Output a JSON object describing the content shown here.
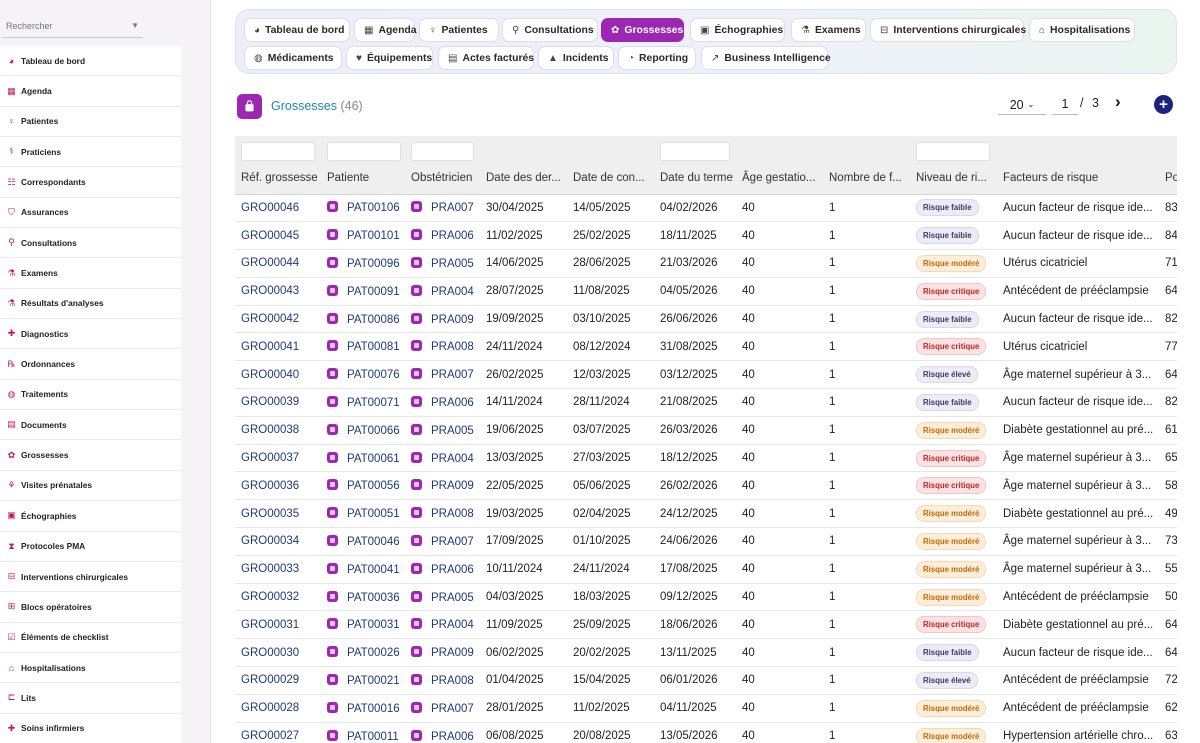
{
  "sidebar": {
    "search_placeholder": "Rechercher",
    "items": [
      {
        "label": "Tableau de bord",
        "icon": "dashboard-icon"
      },
      {
        "label": "Agenda",
        "icon": "calendar-icon"
      },
      {
        "label": "Patientes",
        "icon": "female-icon"
      },
      {
        "label": "Praticiens",
        "icon": "doctor-icon"
      },
      {
        "label": "Correspondants",
        "icon": "contacts-icon"
      },
      {
        "label": "Assurances",
        "icon": "shield-icon"
      },
      {
        "label": "Consultations",
        "icon": "stethoscope-icon"
      },
      {
        "label": "Examens",
        "icon": "exam-icon"
      },
      {
        "label": "Résultats d'analyses",
        "icon": "lab-icon"
      },
      {
        "label": "Diagnostics",
        "icon": "diagnostic-icon"
      },
      {
        "label": "Ordonnances",
        "icon": "prescription-icon"
      },
      {
        "label": "Traitements",
        "icon": "pill-icon"
      },
      {
        "label": "Documents",
        "icon": "document-icon"
      },
      {
        "label": "Grossesses",
        "icon": "pregnancy-icon"
      },
      {
        "label": "Visites prénatales",
        "icon": "visit-icon"
      },
      {
        "label": "Échographies",
        "icon": "ultrasound-icon"
      },
      {
        "label": "Protocoles PMA",
        "icon": "dna-icon"
      },
      {
        "label": "Interventions chirurgicales",
        "icon": "surgery-bed-icon"
      },
      {
        "label": "Blocs opératoires",
        "icon": "operating-room-icon"
      },
      {
        "label": "Éléments de checklist",
        "icon": "checklist-icon"
      },
      {
        "label": "Hospitalisations",
        "icon": "hospital-icon"
      },
      {
        "label": "Lits",
        "icon": "bed-icon"
      },
      {
        "label": "Soins infirmiers",
        "icon": "nursing-icon"
      }
    ]
  },
  "topnav": {
    "tabs": [
      {
        "label": "Tableau de bord",
        "icon": "dashboard-icon",
        "active": false
      },
      {
        "label": "Agenda",
        "icon": "calendar-icon",
        "active": false
      },
      {
        "label": "Patientes",
        "icon": "female-icon",
        "active": false
      },
      {
        "label": "Consultations",
        "icon": "stethoscope-icon",
        "active": false
      },
      {
        "label": "Grossesses",
        "icon": "pregnancy-icon",
        "active": true
      },
      {
        "label": "Échographies",
        "icon": "ultrasound-icon",
        "active": false
      },
      {
        "label": "Examens",
        "icon": "exam-icon",
        "active": false
      },
      {
        "label": "Interventions chirurgicales",
        "icon": "surgery-bed-icon",
        "active": false
      },
      {
        "label": "Hospitalisations",
        "icon": "hospital-icon",
        "active": false
      },
      {
        "label": "Médicaments",
        "icon": "pill-icon",
        "active": false
      },
      {
        "label": "Équipements",
        "icon": "equipment-icon",
        "active": false
      },
      {
        "label": "Actes facturés",
        "icon": "invoice-icon",
        "active": false
      },
      {
        "label": "Incidents",
        "icon": "warning-icon",
        "active": false
      },
      {
        "label": "Reporting",
        "icon": "pie-chart-icon",
        "active": false
      },
      {
        "label": "Business Intelligence",
        "icon": "line-chart-icon",
        "active": false
      }
    ]
  },
  "page": {
    "title": "Grossesses",
    "count": "(46)",
    "accent": "#9c27b0"
  },
  "pagination": {
    "per_page": "20",
    "current": "1",
    "separator": "/",
    "total": "3",
    "next_glyph": "›",
    "add_glyph": "+"
  },
  "table": {
    "columns": [
      "Réf. grossesse",
      "Patiente",
      "Obstétricien",
      "Date des der...",
      "Date de con...",
      "Date du terme",
      "Âge gestatio...",
      "Nombre de f...",
      "Niveau de ri...",
      "Facteurs de risque",
      "Po"
    ],
    "rows": [
      {
        "ref": "GRO00046",
        "patiente": "PAT00106",
        "obst": "PRA007",
        "d1": "30/04/2025",
        "d2": "14/05/2025",
        "d3": "04/02/2026",
        "age": "40",
        "nb": "1",
        "risk": "Risque faible",
        "risk_class": "faible",
        "facteurs": "Aucun facteur de risque ide...",
        "po": "83"
      },
      {
        "ref": "GRO00045",
        "patiente": "PAT00101",
        "obst": "PRA006",
        "d1": "11/02/2025",
        "d2": "25/02/2025",
        "d3": "18/11/2025",
        "age": "40",
        "nb": "1",
        "risk": "Risque faible",
        "risk_class": "faible",
        "facteurs": "Aucun facteur de risque ide...",
        "po": "84"
      },
      {
        "ref": "GRO00044",
        "patiente": "PAT00096",
        "obst": "PRA005",
        "d1": "14/06/2025",
        "d2": "28/06/2025",
        "d3": "21/03/2026",
        "age": "40",
        "nb": "1",
        "risk": "Risque modéré",
        "risk_class": "modere",
        "facteurs": "Utérus cicatriciel",
        "po": "71"
      },
      {
        "ref": "GRO00043",
        "patiente": "PAT00091",
        "obst": "PRA004",
        "d1": "28/07/2025",
        "d2": "11/08/2025",
        "d3": "04/05/2026",
        "age": "40",
        "nb": "1",
        "risk": "Risque critique",
        "risk_class": "critique",
        "facteurs": "Antécédent de prééclampsie",
        "po": "64"
      },
      {
        "ref": "GRO00042",
        "patiente": "PAT00086",
        "obst": "PRA009",
        "d1": "19/09/2025",
        "d2": "03/10/2025",
        "d3": "26/06/2026",
        "age": "40",
        "nb": "1",
        "risk": "Risque faible",
        "risk_class": "faible",
        "facteurs": "Aucun facteur de risque ide...",
        "po": "82"
      },
      {
        "ref": "GRO00041",
        "patiente": "PAT00081",
        "obst": "PRA008",
        "d1": "24/11/2024",
        "d2": "08/12/2024",
        "d3": "31/08/2025",
        "age": "40",
        "nb": "1",
        "risk": "Risque critique",
        "risk_class": "critique",
        "facteurs": "Utérus cicatriciel",
        "po": "77"
      },
      {
        "ref": "GRO00040",
        "patiente": "PAT00076",
        "obst": "PRA007",
        "d1": "26/02/2025",
        "d2": "12/03/2025",
        "d3": "03/12/2025",
        "age": "40",
        "nb": "1",
        "risk": "Risque élevé",
        "risk_class": "eleve",
        "facteurs": "Âge maternel supérieur à 3...",
        "po": "64"
      },
      {
        "ref": "GRO00039",
        "patiente": "PAT00071",
        "obst": "PRA006",
        "d1": "14/11/2024",
        "d2": "28/11/2024",
        "d3": "21/08/2025",
        "age": "40",
        "nb": "1",
        "risk": "Risque faible",
        "risk_class": "faible",
        "facteurs": "Aucun facteur de risque ide...",
        "po": "82"
      },
      {
        "ref": "GRO00038",
        "patiente": "PAT00066",
        "obst": "PRA005",
        "d1": "19/06/2025",
        "d2": "03/07/2025",
        "d3": "26/03/2026",
        "age": "40",
        "nb": "1",
        "risk": "Risque modéré",
        "risk_class": "modere",
        "facteurs": "Diabète gestationnel au pré...",
        "po": "61"
      },
      {
        "ref": "GRO00037",
        "patiente": "PAT00061",
        "obst": "PRA004",
        "d1": "13/03/2025",
        "d2": "27/03/2025",
        "d3": "18/12/2025",
        "age": "40",
        "nb": "1",
        "risk": "Risque critique",
        "risk_class": "critique",
        "facteurs": "Âge maternel supérieur à 3...",
        "po": "65"
      },
      {
        "ref": "GRO00036",
        "patiente": "PAT00056",
        "obst": "PRA009",
        "d1": "22/05/2025",
        "d2": "05/06/2025",
        "d3": "26/02/2026",
        "age": "40",
        "nb": "1",
        "risk": "Risque critique",
        "risk_class": "critique",
        "facteurs": "Âge maternel supérieur à 3...",
        "po": "58"
      },
      {
        "ref": "GRO00035",
        "patiente": "PAT00051",
        "obst": "PRA008",
        "d1": "19/03/2025",
        "d2": "02/04/2025",
        "d3": "24/12/2025",
        "age": "40",
        "nb": "1",
        "risk": "Risque modéré",
        "risk_class": "modere",
        "facteurs": "Diabète gestationnel au pré...",
        "po": "49"
      },
      {
        "ref": "GRO00034",
        "patiente": "PAT00046",
        "obst": "PRA007",
        "d1": "17/09/2025",
        "d2": "01/10/2025",
        "d3": "24/06/2026",
        "age": "40",
        "nb": "1",
        "risk": "Risque modéré",
        "risk_class": "modere",
        "facteurs": "Âge maternel supérieur à 3...",
        "po": "73"
      },
      {
        "ref": "GRO00033",
        "patiente": "PAT00041",
        "obst": "PRA006",
        "d1": "10/11/2024",
        "d2": "24/11/2024",
        "d3": "17/08/2025",
        "age": "40",
        "nb": "1",
        "risk": "Risque modéré",
        "risk_class": "modere",
        "facteurs": "Âge maternel supérieur à 3...",
        "po": "55"
      },
      {
        "ref": "GRO00032",
        "patiente": "PAT00036",
        "obst": "PRA005",
        "d1": "04/03/2025",
        "d2": "18/03/2025",
        "d3": "09/12/2025",
        "age": "40",
        "nb": "1",
        "risk": "Risque modéré",
        "risk_class": "modere",
        "facteurs": "Antécédent de prééclampsie",
        "po": "50"
      },
      {
        "ref": "GRO00031",
        "patiente": "PAT00031",
        "obst": "PRA004",
        "d1": "11/09/2025",
        "d2": "25/09/2025",
        "d3": "18/06/2026",
        "age": "40",
        "nb": "1",
        "risk": "Risque critique",
        "risk_class": "critique",
        "facteurs": "Diabète gestationnel au pré...",
        "po": "64"
      },
      {
        "ref": "GRO00030",
        "patiente": "PAT00026",
        "obst": "PRA009",
        "d1": "06/02/2025",
        "d2": "20/02/2025",
        "d3": "13/11/2025",
        "age": "40",
        "nb": "1",
        "risk": "Risque faible",
        "risk_class": "faible",
        "facteurs": "Aucun facteur de risque ide...",
        "po": "64"
      },
      {
        "ref": "GRO00029",
        "patiente": "PAT00021",
        "obst": "PRA008",
        "d1": "01/04/2025",
        "d2": "15/04/2025",
        "d3": "06/01/2026",
        "age": "40",
        "nb": "1",
        "risk": "Risque élevé",
        "risk_class": "eleve",
        "facteurs": "Antécédent de prééclampsie",
        "po": "72"
      },
      {
        "ref": "GRO00028",
        "patiente": "PAT00016",
        "obst": "PRA007",
        "d1": "28/01/2025",
        "d2": "11/02/2025",
        "d3": "04/11/2025",
        "age": "40",
        "nb": "1",
        "risk": "Risque modéré",
        "risk_class": "modere",
        "facteurs": "Antécédent de prééclampsie",
        "po": "62"
      },
      {
        "ref": "GRO00027",
        "patiente": "PAT00011",
        "obst": "PRA006",
        "d1": "06/08/2025",
        "d2": "20/08/2025",
        "d3": "13/05/2026",
        "age": "40",
        "nb": "1",
        "risk": "Risque modéré",
        "risk_class": "modere",
        "facteurs": "Hypertension artérielle chro...",
        "po": "63"
      }
    ]
  }
}
